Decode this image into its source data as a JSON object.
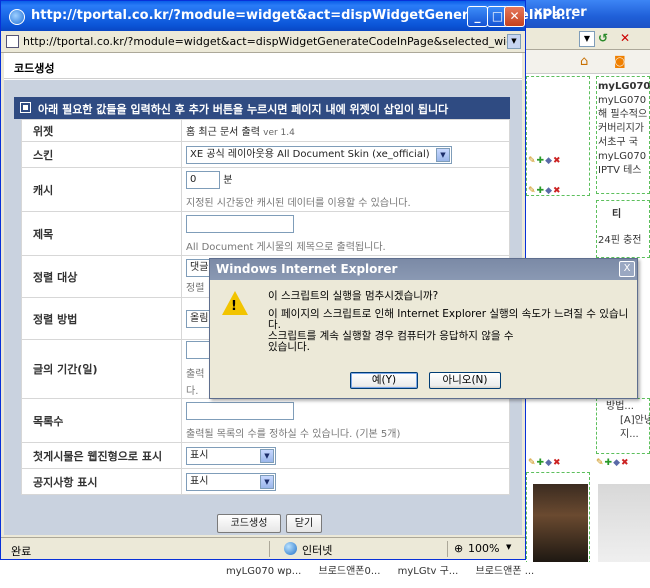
{
  "background_window": {
    "title_visible": "xplorer",
    "bottom_links": [
      "myLG070 wp...",
      "브로드앤폰0...",
      "myLGtv 구...",
      "브로드앤폰 ..."
    ],
    "widget_list_1": [
      "myLG070",
      "myLG070",
      "해 필수적으",
      "커버리지가",
      "서초구 국",
      "myLG070",
      "IPTV 테스"
    ],
    "widget_list_2_heading": "티",
    "widget_list_2": [
      "24핀 충전"
    ],
    "widget_list_3": [
      "방법...",
      "[A]안녕",
      "지..."
    ]
  },
  "popup": {
    "title": "http://tportal.co.kr/?module=widget&act=dispWidgetGenerateCodeInPa...",
    "address": "http://tportal.co.kr/?module=widget&act=dispWidgetGenerateCodeInPage&selected_widget=Alldocume",
    "page_title": "코드생성",
    "info_bar": "아래 필요한 값들을 입력하신 후 추가 버튼을 누르시면 페이지 내에 위젯이 삽입이 됩니다",
    "rows": [
      {
        "label": "위젯",
        "value": "홈 최근 문서 출력",
        "version": "ver 1.4"
      },
      {
        "label": "스킨",
        "select": "XE 공식 레이아웃용 All Document Skin (xe_official)"
      },
      {
        "label": "캐시",
        "input": "0",
        "unit": "분",
        "help": "지정된 시간동안 캐시된 데이터를 이용할 수 있습니다."
      },
      {
        "label": "제목",
        "input": "",
        "help": "All Document 게시물의 제목으로 출력됩니다."
      },
      {
        "label": "정렬 대상",
        "select": "댓글",
        "help": "정렬"
      },
      {
        "label": "정렬 방법",
        "select": "올림"
      },
      {
        "label": "글의 기간(일)",
        "input": "",
        "help": "출력",
        "help2": "다."
      },
      {
        "label": "목록수",
        "input": "",
        "help": "출력될 목록의 수를 정하실 수 있습니다. (기본 5개)"
      },
      {
        "label": "첫게시물은 웹진형으로 표시",
        "select": "표시"
      },
      {
        "label": "공지사항 표시",
        "select": "표시"
      }
    ],
    "buttons": {
      "generate": "코드생성",
      "close": "닫기"
    },
    "status": {
      "text": "완료",
      "zone": "인터넷",
      "zoom": "100%"
    }
  },
  "dialog": {
    "title": "Windows Internet Explorer",
    "close": "X",
    "question": "이 스크립트의 실행을 멈추시겠습니까?",
    "body_line1": "이 페이지의 스크립트로 인해 Internet Explorer 실행의 속도가 느려질 수 있습니다.",
    "body_line2": "스크립트를 계속 실행할 경우 컴퓨터가 응답하지 않을 수",
    "body_line3": "있습니다.",
    "yes": "예(Y)",
    "no": "아니오(N)"
  },
  "colors": {
    "popup_title": "#0b55d8",
    "info_bar": "#2f4b82",
    "dialog_title": "#7b8aa6",
    "warn": "#f2c400"
  }
}
